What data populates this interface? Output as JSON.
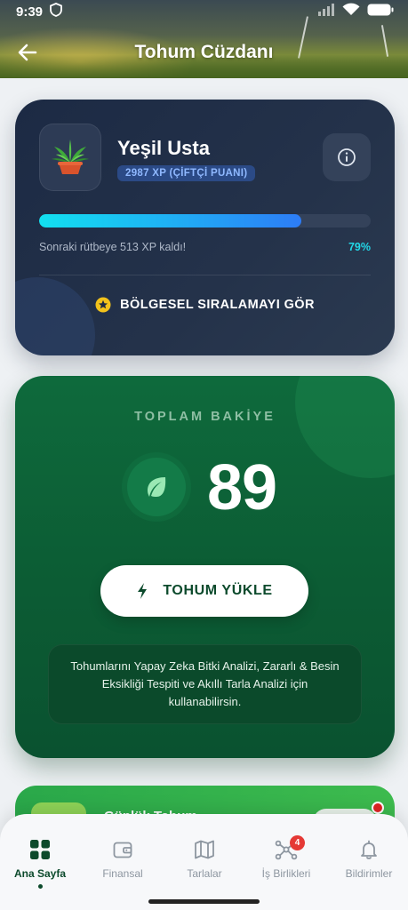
{
  "status_bar": {
    "time": "9:39"
  },
  "header": {
    "title": "Tohum Cüzdanı"
  },
  "profile": {
    "name": "Yeşil Usta",
    "xp_badge": "2987 XP (ÇİFTÇİ PUANI)",
    "progress_fraction": 0.79,
    "progress_text": "Sonraki rütbeye 513 XP kaldı!",
    "progress_percent": "79%",
    "ranking_link": "BÖLGESEL SIRALAMAYI GÖR"
  },
  "balance": {
    "label": "TOPLAM BAKİYE",
    "value": "89",
    "load_button": "TOHUM YÜKLE",
    "info_text": "Tohumlarını Yapay Zeka Bitki Analizi, Zararlı & Besin Eksikliği Tespiti ve Akıllı Tarla Analizi için kullanabilirsin."
  },
  "next_card": {
    "title": "Günlük Tohum"
  },
  "bottom_nav": {
    "items": [
      {
        "label": "Ana Sayfa",
        "icon": "grid-icon",
        "active": true
      },
      {
        "label": "Finansal",
        "icon": "wallet-icon",
        "active": false
      },
      {
        "label": "Tarlalar",
        "icon": "map-icon",
        "active": false
      },
      {
        "label": "İş Birlikleri",
        "icon": "network-icon",
        "active": false,
        "badge": "4"
      },
      {
        "label": "Bildirimler",
        "icon": "bell-icon",
        "active": false
      }
    ]
  },
  "colors": {
    "profile_card": "#1c2a44",
    "balance_card": "#0e6a3c",
    "progress_accent": "#12e0f0",
    "active_nav": "#0c4a2c",
    "notification_badge": "#e53935"
  }
}
